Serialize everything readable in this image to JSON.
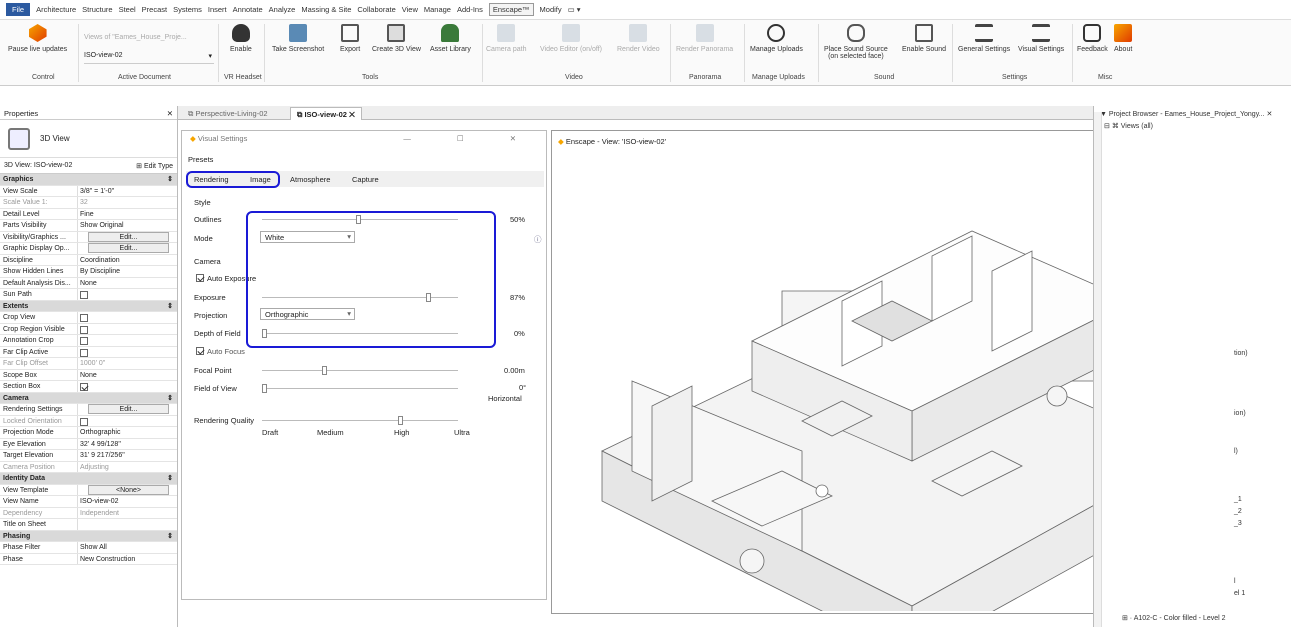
{
  "menu": [
    "File",
    "Architecture",
    "Structure",
    "Steel",
    "Precast",
    "Systems",
    "Insert",
    "Annotate",
    "Analyze",
    "Massing & Site",
    "Collaborate",
    "View",
    "Manage",
    "Add-Ins",
    "Enscape™",
    "Modify",
    "▭ ▾"
  ],
  "ribbon": {
    "pause_label": "Pause live updates",
    "doc_value": "ISO-view-02",
    "doc_placeholder": "Views of \"Eames_House_Proje...",
    "enable": "Enable",
    "take_screenshot": "Take Screenshot",
    "export": "Export",
    "create_3d": "Create 3D View",
    "asset_library": "Asset Library",
    "camera_path": "Camera path",
    "video_editor": "Video Editor (on/off)",
    "render_video": "Render Video",
    "render_panorama": "Render Panorama",
    "manage_uploads1": "Manage Uploads",
    "manage_uploads2": "Manage Uploads",
    "place_sound": "Place Sound Source",
    "place_sound2": "(on selected face)",
    "enable_sound": "Enable Sound",
    "general_settings": "General Settings",
    "visual_settings": "Visual Settings",
    "feedback": "Feedback",
    "about": "About",
    "panels": {
      "control": "Control",
      "active_document": "Active Document",
      "vr": "VR Headset",
      "tools": "Tools",
      "video": "Video",
      "panorama": "Panorama",
      "manage_uploads": "Manage Uploads",
      "sound": "Sound",
      "settings": "Settings",
      "misc": "Misc"
    }
  },
  "properties": {
    "title": "Properties",
    "view_type": "3D View",
    "type_selector": "3D View: ISO-view-02",
    "edit_type": "Edit Type",
    "rows": [
      {
        "k": "Graphics",
        "sec": true
      },
      {
        "k": "View Scale",
        "v": "3/8\" = 1'-0\""
      },
      {
        "k": "Scale Value    1:",
        "v": "32",
        "dim": true
      },
      {
        "k": "Detail Level",
        "v": "Fine"
      },
      {
        "k": "Parts Visibility",
        "v": "Show Original"
      },
      {
        "k": "Visibility/Graphics ...",
        "v": "Edit...",
        "btn": true
      },
      {
        "k": "Graphic Display Op...",
        "v": "Edit...",
        "btn": true
      },
      {
        "k": "Discipline",
        "v": "Coordination"
      },
      {
        "k": "Show Hidden Lines",
        "v": "By Discipline"
      },
      {
        "k": "Default Analysis Dis...",
        "v": "None"
      },
      {
        "k": "Sun Path",
        "chk": false
      },
      {
        "k": "Extents",
        "sec": true
      },
      {
        "k": "Crop View",
        "chk": false
      },
      {
        "k": "Crop Region Visible",
        "chk": false
      },
      {
        "k": "Annotation Crop",
        "chk": false
      },
      {
        "k": "Far Clip Active",
        "chk": false
      },
      {
        "k": "Far Clip Offset",
        "v": "1000'  0\"",
        "dim": true
      },
      {
        "k": "Scope Box",
        "v": "None"
      },
      {
        "k": "Section Box",
        "chk": true
      },
      {
        "k": "Camera",
        "sec": true
      },
      {
        "k": "Rendering Settings",
        "v": "Edit...",
        "btn": true
      },
      {
        "k": "Locked Orientation",
        "chk": false,
        "dim": true
      },
      {
        "k": "Projection Mode",
        "v": "Orthographic"
      },
      {
        "k": "Eye Elevation",
        "v": "32'  4 99/128\""
      },
      {
        "k": "Target Elevation",
        "v": "31'  9 217/256\""
      },
      {
        "k": "Camera Position",
        "v": "Adjusting",
        "dim": true
      },
      {
        "k": "Identity Data",
        "sec": true
      },
      {
        "k": "View Template",
        "v": "<None>",
        "btn": true
      },
      {
        "k": "View Name",
        "v": "ISO-view-02"
      },
      {
        "k": "Dependency",
        "v": "Independent",
        "dim": true
      },
      {
        "k": "Title on Sheet",
        "v": ""
      },
      {
        "k": "Phasing",
        "sec": true
      },
      {
        "k": "Phase Filter",
        "v": "Show All"
      },
      {
        "k": "Phase",
        "v": "New Construction"
      }
    ]
  },
  "view_tabs": {
    "tab1": "Perspective-Living-02",
    "tab2": "ISO-view-02",
    "close": "✕"
  },
  "visual_settings": {
    "title": "Visual Settings",
    "presets": "Presets",
    "tabs": {
      "rendering": "Rendering",
      "image": "Image",
      "atmosphere": "Atmosphere",
      "capture": "Capture"
    },
    "style": "Style",
    "outlines": "Outlines",
    "outlines_val": "50%",
    "outlines_pct": 0.5,
    "mode": "Mode",
    "mode_val": "White",
    "camera": "Camera",
    "auto_exposure": "Auto Exposure",
    "exposure": "Exposure",
    "exposure_val": "87%",
    "exposure_pct": 0.87,
    "projection": "Projection",
    "projection_val": "Orthographic",
    "dof": "Depth of Field",
    "dof_val": "0%",
    "auto_focus": "Auto Focus",
    "focal_point": "Focal Point",
    "focal_val": "0.00m",
    "fov": "Field of View",
    "fov_val": "0°",
    "fov_sub": "Horizontal",
    "rq": "Rendering Quality",
    "rq_levels": [
      "Draft",
      "Medium",
      "High",
      "Ultra"
    ],
    "info": "ⓘ"
  },
  "enscape_window": {
    "title": "Enscape - View: 'ISO-view-02'",
    "min": "—",
    "max": "☐",
    "close": "✕"
  },
  "project_browser": {
    "title": "Project Browser - Eames_House_Project_Yongy...",
    "views": "Views (all)",
    "items": [
      "tion)",
      "ion)",
      "l)",
      "_1",
      "_2",
      "_3",
      "l",
      "el 1",
      "A102-C - Color filled - Level 2"
    ]
  }
}
